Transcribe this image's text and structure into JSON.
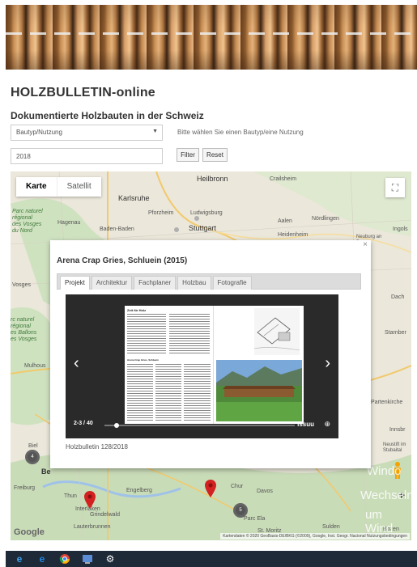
{
  "site": {
    "title": "HOLZBULLETIN-online",
    "subtitle": "Dokumentierte Holzbauten in der Schweiz"
  },
  "filters": {
    "type_select_value": "Bautyp/Nutzung",
    "type_hint": "Bitte wählen Sie einen Bautyp/eine Nutzung",
    "year_value": "2018",
    "filter_label": "Filter",
    "reset_label": "Reset"
  },
  "map": {
    "type_tabs": [
      "Karte",
      "Satellit"
    ],
    "active_type": "Karte",
    "fullscreen_icon": "fullscreen-icon",
    "labels": {
      "heilbronn": "Heilbronn",
      "crailsheim": "Crailsheim",
      "karlsruhe": "Karlsruhe",
      "parc_naturel": "Parc naturel\nrégional\ndes Vosges\ndu Nord",
      "pforzheim": "Pforzheim",
      "ludwigsburg": "Ludwigsburg",
      "aalen": "Aalen",
      "nordlingen": "Nördlingen",
      "ingols": "Ingols",
      "hagenau": "Hagenau",
      "baden_baden": "Baden-Baden",
      "stuttgart": "Stuttgart",
      "heidenheim": "Heidenheim",
      "neuburg": "Neuburg an\nDonau",
      "vosges": "Vosges",
      "dach": "Dach",
      "parc_ballons": "rc naturel\nrégional\nes Ballons\nes Vosges",
      "starnberg": "Starnber",
      "mulhouse": "Mulhous",
      "partenkirchen": "Partenkirche",
      "innsbr": "Innsbr",
      "biel": "Biel",
      "neustift": "Neustift im\nStubaital",
      "bern": "Be",
      "freiburg": "Freiburg",
      "thun": "Thun",
      "engelberg": "Engelberg",
      "chur": "Chur",
      "davos": "Davos",
      "interlaken": "Interlaken",
      "grindelwald": "Grindelwald",
      "lauterbrunnen": "Lauterbrunnen",
      "parc_ela": "Parc Ela",
      "sulden": "Sulden",
      "st_moritz": "St. Moritz",
      "bozen": "Bozen"
    },
    "clusters": [
      "4",
      "5"
    ],
    "google_logo": "Google",
    "attribution": "Kartendaten © 2020 GeoBasis-DE/BKG (©2009), Google, Inst. Geogr. Nacional   Nutzungsbedingungen",
    "zoom_plus": "+",
    "watermark": [
      "Windo",
      "Wechseln",
      "um Wind"
    ]
  },
  "popup": {
    "close": "×",
    "title": "Arena Crap Gries, Schluein (2015)",
    "tabs": [
      "Projekt",
      "Architektur",
      "Fachplaner",
      "Holzbau",
      "Fotografie"
    ],
    "active_tab": "Projekt",
    "viewer": {
      "page_counter": "2-3 / 40",
      "progress_fraction": 0.05,
      "brand": "issuu",
      "prev_arrow": "‹",
      "next_arrow": "›",
      "left_page_heading": "Zeit für Holz",
      "left_page_subheading": "Arena Crap Gries, Schluein"
    },
    "caption": "Holzbulletin 128/2018"
  },
  "taskbar": {
    "icons": [
      "edge-icon",
      "ie-icon",
      "chrome-icon",
      "app-icon",
      "settings-icon"
    ]
  },
  "colors": {
    "pin_red": "#d32020",
    "taskbar": "#1e2a38"
  }
}
